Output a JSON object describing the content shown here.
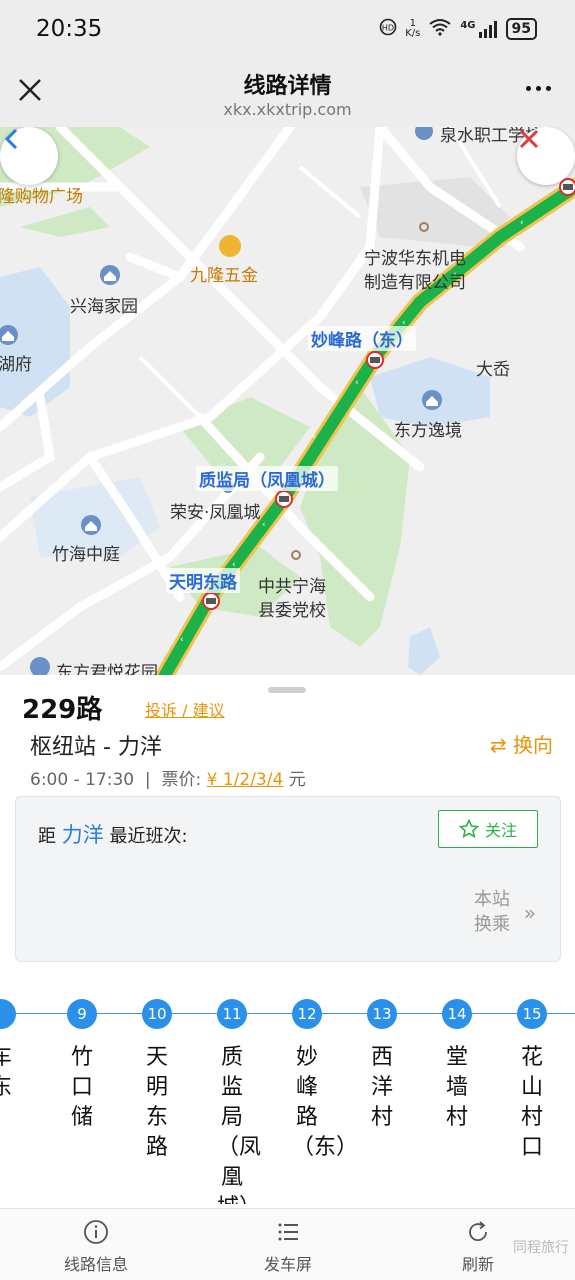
{
  "status": {
    "time": "20:35",
    "net_speed_value": "1",
    "net_speed_unit": "K/s",
    "net_type": "4G",
    "battery": "95"
  },
  "nav": {
    "title": "线路详情",
    "url": "xkx.xkxtrip.com"
  },
  "map": {
    "labels": {
      "top_right": "泉水职工学校",
      "shopping": "隆购物广场",
      "huadong": "宁波华东机电",
      "huadong2": "制造有限公司",
      "jiulong": "九隆五金",
      "xinghai": "兴海家园",
      "hufu": "湖府",
      "dacuo": "大岙",
      "dongfang": "东方逸境",
      "rongan": "荣安·凤凰城",
      "zhuhai": "竹海中庭",
      "party_school1": "中共宁海",
      "party_school2": "县委党校",
      "junyue": "东方君悦花园"
    },
    "stops": {
      "miaofeng": "妙峰路（东）",
      "zhijian": "质监局（凤凰城）",
      "tianming": "天明东路"
    },
    "route_color": "#1db14a"
  },
  "route": {
    "name": "229路",
    "complaint": "投诉 / 建议",
    "direction": "枢纽站 - 力洋",
    "swap": "换向",
    "hours": "6:00 - 17:30",
    "fare_label": "票价:",
    "fare": "¥ 1/2/3/4",
    "fare_unit": "元"
  },
  "nearest": {
    "prefix": "距",
    "destination": "力洋",
    "suffix": "最近班次:",
    "follow": "关注",
    "transfer_line1": "本站",
    "transfer_line2": "换乘"
  },
  "stops": [
    {
      "num": "",
      "name": "车东"
    },
    {
      "num": "9",
      "name": "竹口储"
    },
    {
      "num": "10",
      "name": "天明东路"
    },
    {
      "num": "11",
      "name": "质监局（凤凰城）"
    },
    {
      "num": "12",
      "name": "妙峰路（东）"
    },
    {
      "num": "13",
      "name": "西洋村"
    },
    {
      "num": "14",
      "name": "堂墙村"
    },
    {
      "num": "15",
      "name": "花山村口"
    }
  ],
  "tabs": [
    {
      "label": "线路信息",
      "icon": "info-icon"
    },
    {
      "label": "发车屏",
      "icon": "list-icon"
    },
    {
      "label": "刷新",
      "icon": "refresh-icon"
    }
  ],
  "watermark": "同程旅行"
}
